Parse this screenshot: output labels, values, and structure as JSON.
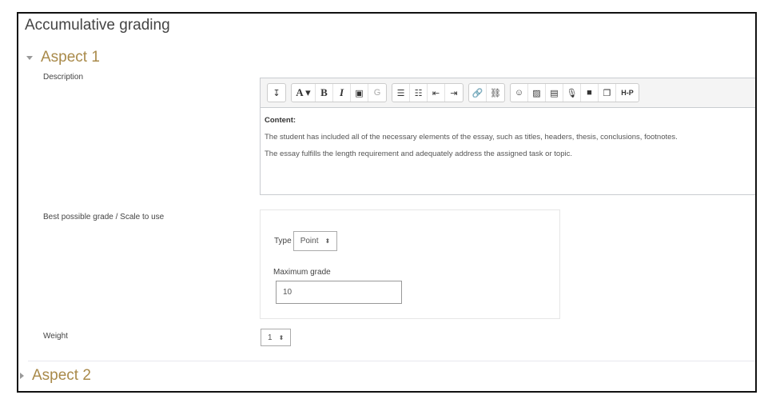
{
  "page": {
    "title": "Accumulative grading"
  },
  "aspects": [
    {
      "title": "Aspect 1",
      "expanded": true,
      "description_label": "Description",
      "editor": {
        "toolbar_groups": [
          [
            {
              "icon": "collapse-icon",
              "glyph": "↧"
            }
          ],
          [
            {
              "icon": "font-color-icon",
              "glyph": "A ▾"
            },
            {
              "icon": "bold-icon",
              "glyph": "B"
            },
            {
              "icon": "italic-icon",
              "glyph": "I"
            },
            {
              "icon": "equation-icon",
              "glyph": "▣"
            },
            {
              "icon": "glossary-icon",
              "glyph": "G"
            }
          ],
          [
            {
              "icon": "unordered-list-icon",
              "glyph": "☰"
            },
            {
              "icon": "ordered-list-icon",
              "glyph": "☷"
            },
            {
              "icon": "outdent-icon",
              "glyph": "⇤"
            },
            {
              "icon": "indent-icon",
              "glyph": "⇥"
            }
          ],
          [
            {
              "icon": "link-icon",
              "glyph": "🔗"
            },
            {
              "icon": "unlink-icon",
              "glyph": "⛓"
            }
          ],
          [
            {
              "icon": "emoji-icon",
              "glyph": "☺"
            },
            {
              "icon": "image-icon",
              "glyph": "▨"
            },
            {
              "icon": "media-icon",
              "glyph": "▤"
            },
            {
              "icon": "record-audio-icon",
              "glyph": "🎙"
            },
            {
              "icon": "record-video-icon",
              "glyph": "■"
            },
            {
              "icon": "manage-files-icon",
              "glyph": "❐"
            },
            {
              "icon": "h5p-icon",
              "glyph": "H-P"
            }
          ]
        ],
        "content": {
          "heading": "Content:",
          "paragraphs": [
            "The student has included all of the necessary elements of the essay, such as titles, headers, thesis, conclusions, footnotes.",
            "The essay fulfills the length requirement and adequately address the assigned task or topic."
          ]
        }
      },
      "grade_label": "Best possible grade / Scale to use",
      "grade": {
        "type_label": "Type",
        "type_value": "Point",
        "max_label": "Maximum grade",
        "max_value": "10"
      },
      "weight_label": "Weight",
      "weight_value": "1"
    },
    {
      "title": "Aspect 2",
      "expanded": false
    }
  ],
  "colors": {
    "aspect_heading": "#a98a4a",
    "frame_border": "#111111"
  }
}
